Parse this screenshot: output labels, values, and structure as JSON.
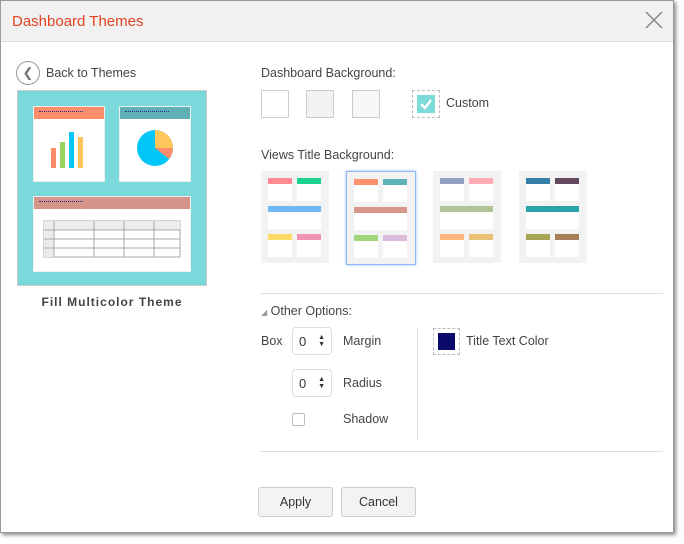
{
  "dialog": {
    "title": "Dashboard Themes"
  },
  "left": {
    "back_label": "Back to Themes",
    "theme_name": "Fill Multicolor Theme"
  },
  "preview": {
    "background": "#7ad9da",
    "bar_colors": [
      "#ff8c6b",
      "#96d35f",
      "#00c7f7",
      "#ffc65b"
    ],
    "header_colors": [
      "#ff8c6b",
      "#5fb0b5",
      "#d6958b"
    ]
  },
  "background": {
    "label": "Dashboard Background:",
    "swatches": [
      "#ffffff",
      "#f2f2f2",
      "#f7f7f7"
    ],
    "custom_label": "Custom",
    "custom_color": "#7adbd9",
    "custom_checked": true
  },
  "views_title": {
    "label": "Views Title Background:",
    "themes": [
      {
        "colors": [
          "#ff8a94",
          "#1bd18f",
          "#6db8f5",
          "#ffd966",
          "#f093b4"
        ],
        "selected": false
      },
      {
        "colors": [
          "#ff916f",
          "#5cb2b5",
          "#d8968c",
          "#a2d67b",
          "#dcbcdb"
        ],
        "selected": true
      },
      {
        "colors": [
          "#8e9fc2",
          "#ffadb5",
          "#afc394",
          "#ffb57f",
          "#e8c174"
        ],
        "selected": false
      },
      {
        "colors": [
          "#367fa9",
          "#654a5f",
          "#29a3a8",
          "#a5a555",
          "#a57f58"
        ],
        "selected": false
      }
    ]
  },
  "other": {
    "label": "Other Options:",
    "box_label": "Box",
    "margin_value": "0",
    "margin_label": "Margin",
    "radius_value": "0",
    "radius_label": "Radius",
    "shadow_label": "Shadow",
    "shadow_checked": false,
    "title_color": "#0a0a6a",
    "title_color_label": "Title Text Color"
  },
  "buttons": {
    "apply": "Apply",
    "cancel": "Cancel"
  }
}
